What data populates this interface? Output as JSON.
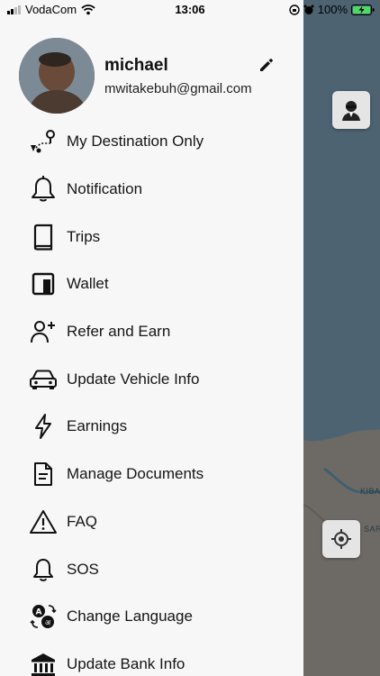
{
  "status_bar": {
    "carrier": "VodaCom",
    "time": "13:06",
    "battery": "100%"
  },
  "profile": {
    "name": "michael",
    "email": "mwitakebuh@gmail.com"
  },
  "menu": [
    {
      "label": "My Destination Only",
      "icon": "destination-route-icon"
    },
    {
      "label": "Notification",
      "icon": "bell-icon"
    },
    {
      "label": "Trips",
      "icon": "book-icon"
    },
    {
      "label": "Wallet",
      "icon": "wallet-icon"
    },
    {
      "label": "Refer and Earn",
      "icon": "person-add-icon"
    },
    {
      "label": "Update Vehicle Info",
      "icon": "car-icon"
    },
    {
      "label": "Earnings",
      "icon": "lightning-icon"
    },
    {
      "label": "Manage Documents",
      "icon": "document-icon"
    },
    {
      "label": "FAQ",
      "icon": "warning-icon"
    },
    {
      "label": "SOS",
      "icon": "bell-outline-icon"
    },
    {
      "label": "Change Language",
      "icon": "language-icon"
    },
    {
      "label": "Update Bank Info",
      "icon": "bank-icon"
    }
  ],
  "map": {
    "labels": [
      "KIBAD",
      "SAR"
    ]
  }
}
